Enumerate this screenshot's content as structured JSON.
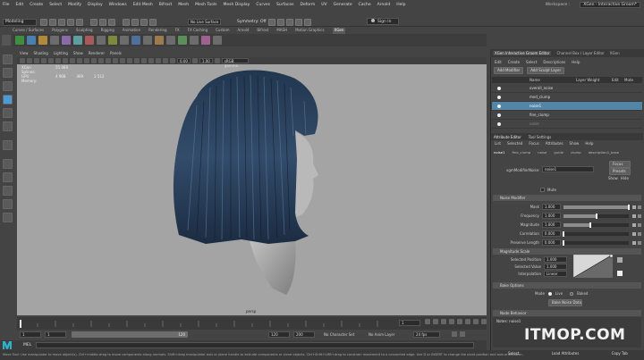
{
  "menu": [
    "File",
    "Edit",
    "Create",
    "Select",
    "Modify",
    "Display",
    "Windows",
    "Edit Mesh",
    "Bifrost",
    "Mesh",
    "Mesh Tools",
    "Mesh Display",
    "Curves",
    "Surfaces",
    "Deform",
    "UV",
    "Generate",
    "Cache",
    "Arnold",
    "Help"
  ],
  "workspace": {
    "label": "Workspace :",
    "value": "XGen - Interactive Groom*"
  },
  "status_line": {
    "mode": "Modeling",
    "live_surface": "No Live Surface",
    "symmetry": "Symmetry: Off",
    "sign_in": "Sign In"
  },
  "shelf_tabs": [
    "Curves / Surfaces",
    "Polygons",
    "Sculpting",
    "Rigging",
    "Animation",
    "Rendering",
    "FX",
    "FX Caching",
    "Custom",
    "Arnold",
    "Bifrost",
    "MASH",
    "Motion Graphics",
    "XGen"
  ],
  "shelf_active": "XGen",
  "viewport": {
    "menu": [
      "View",
      "Shading",
      "Lighting",
      "Show",
      "Renderer",
      "Panels"
    ],
    "field_a": "0.00",
    "field_b": "1.00",
    "color_space": "sRGB gamma",
    "hud": [
      {
        "label": "XGen Splines:",
        "v1": "55 469",
        "v2": "",
        "v3": ""
      },
      {
        "label": "GPU Memory:",
        "v1": "4 908",
        "v2": "469",
        "v3": "2 512"
      }
    ],
    "camera": "persp"
  },
  "timeline": {
    "current": "1",
    "start": "1",
    "range_start": "1",
    "range_handle": "120",
    "range_end": "120",
    "end": "200",
    "character_set": "No Character Set",
    "anim_layer": "No Anim Layer",
    "fps": "24 fps",
    "frame_field": "1"
  },
  "mel_label": "MEL",
  "help_text": "Move Tool: Use manipulator to move object(s). Ctrl+middle-drag to move components along normals. Shift+drag manipulator axis or plane handle to extrude components or clone objects. Ctrl+Shift+LMB+drag to constrain movement to a connected edge. Use D or INSERT to change the pivot position and axis orientation.",
  "right_panel": {
    "tabs": [
      "XGen Interactive Groom Editor",
      "Channel Box / Layer Editor",
      "XGen"
    ],
    "menu": [
      "Edit",
      "Create",
      "Select",
      "Descriptions",
      "Help"
    ],
    "add_modifier": "Add Modifier",
    "add_sculpt_layer": "Add Sculpt Layer",
    "layer_columns": {
      "name": "Name",
      "layer_weight": "Layer Weight",
      "edit": "Edit",
      "mute": "Mute"
    },
    "layers": [
      {
        "name": "overall_noise",
        "selected": false
      },
      {
        "name": "med_clump",
        "selected": false
      },
      {
        "name": "noise1",
        "selected": true
      },
      {
        "name": "fine_clump",
        "selected": false
      },
      {
        "name": "noise",
        "selected": false
      }
    ],
    "attr_tabs": [
      "Attribute Editor",
      "Tool Settings"
    ],
    "attr_menu": [
      "List",
      "Selected",
      "Focus",
      "Attributes",
      "Show",
      "Help"
    ],
    "node_tabs": [
      "noise1",
      "fine_clump",
      "noise",
      "guide",
      "clump",
      "description1_base"
    ],
    "node_label": "xgmModifierNoise:",
    "node_value": "noise1",
    "focus": "Focus",
    "presets": "Presets",
    "show": "Show",
    "hide": "Hide",
    "mute_label": "Mute",
    "noise_section": "Noise Modifier",
    "params": [
      {
        "label": "Mask",
        "value": "1.000",
        "level": 1.0
      },
      {
        "label": "Frequency",
        "value": "1.000",
        "level": 0.5
      },
      {
        "label": "Magnitude",
        "value": "1.000",
        "level": 0.4
      },
      {
        "label": "Correlation",
        "value": "0.000",
        "level": 0.0
      },
      {
        "label": "Preserve Length",
        "value": "0.000",
        "level": 0.0
      }
    ],
    "magnitude_section": "Magnitude Scale",
    "selected_position": {
      "label": "Selected Position",
      "value": "1.000"
    },
    "selected_value": {
      "label": "Selected Value",
      "value": "1.000"
    },
    "interpolation": {
      "label": "Interpolation",
      "value": "Linear"
    },
    "bake_section": "Bake Options",
    "mode_label": "Mode",
    "mode_options": [
      "Live",
      "Baked"
    ],
    "bake_button": "Bake Noise Data",
    "node_behavior": "Node Behavior",
    "notes": "Notes: noise1",
    "bottom_buttons": [
      "Select",
      "Load Attributes",
      "Copy Tab"
    ]
  },
  "watermark": "ITMOP.COM",
  "colors": {
    "accent": "#5285a6",
    "viewport": "#a4a4a4",
    "panel": "#444444"
  }
}
